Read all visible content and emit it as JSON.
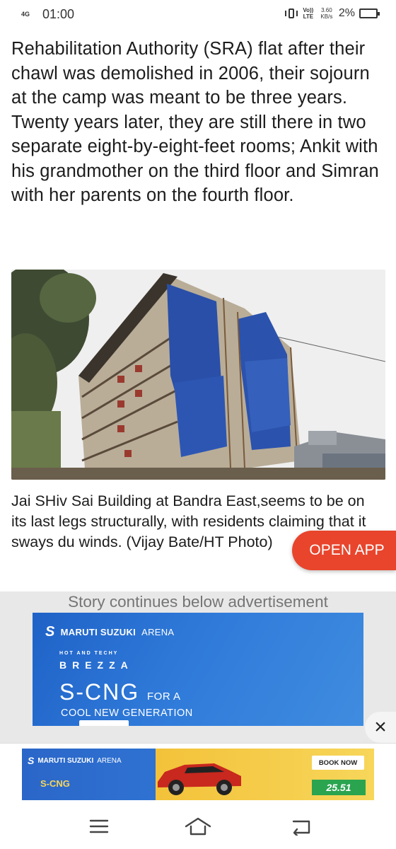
{
  "status_bar": {
    "network": "4G",
    "time": "01:00",
    "volte_top": "Vo))",
    "volte_bottom": "LTE",
    "speed_value": "3.60",
    "speed_unit": "KB/s",
    "battery": "2%"
  },
  "article": {
    "paragraph": "Rehabilitation Authority (SRA) flat after their chawl was demolished in 2006, their sojourn at the camp was meant to be three years. Twenty years later, they are still there in two separate eight-by-eight-feet rooms; Ankit with his grandmother on the third floor and Simran with her parents on the fourth floor.",
    "caption": "Jai SHiv Sai Building at Bandra East,seems to be on its last legs structurally, with residents claiming that it sways du winds. (Vijay Bate/HT Photo)"
  },
  "open_app": {
    "label": "OPEN APP"
  },
  "ad": {
    "notice": "Story continues below advertisement",
    "banner": {
      "logo_mark": "S",
      "logo_brand": "MARUTI SUZUKI",
      "logo_arena": "ARENA",
      "tagline": "HOT AND TECHY",
      "model": "BREZZA",
      "headline": "S-CNG",
      "headline_suffix": "FOR A",
      "subline": "COOL NEW GENERATION"
    },
    "close_symbol": "×"
  },
  "bottom_ad": {
    "logo_mark": "S",
    "logo_brand": "MARUTI SUZUKI",
    "logo_arena": "ARENA",
    "badge": "S-CNG",
    "book_now": "BOOK NOW",
    "mileage": "25.51"
  },
  "nav": {
    "menu_icon": "menu-icon",
    "home_icon": "home-icon",
    "back_icon": "back-icon"
  },
  "colors": {
    "open_app_bg": "#e8452c",
    "ad_blue": "#2f7ad9",
    "ad_section_bg": "#e8e8e8"
  }
}
